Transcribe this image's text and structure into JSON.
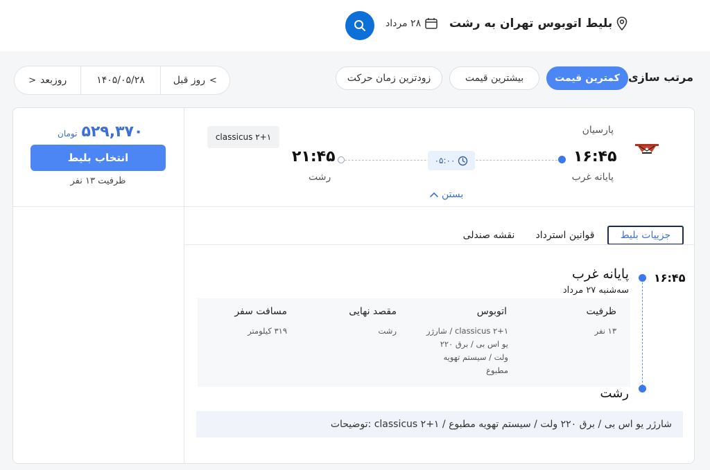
{
  "header": {
    "route_title": "بلیط اتوبوس تهران به رشت",
    "date": "۲۸ مرداد"
  },
  "sort": {
    "label": "مرتب سازی:",
    "options": [
      "کمترین قیمت",
      "بیشترین قیمت",
      "زودترین زمان حرکت"
    ],
    "active": "کمترین قیمت"
  },
  "date_nav": {
    "prev_label": "روز قبل",
    "current": "۱۴۰۵/۰۵/۲۸",
    "next_label": "روزبعد"
  },
  "ticket": {
    "company": "پارسیان",
    "bus_type": "classicus ۲+۱",
    "departure_time": "۱۶:۴۵",
    "departure_place": "پایانه غرب",
    "arrival_time": "۲۱:۴۵",
    "arrival_place": "رشت",
    "duration": "۰۵:۰۰",
    "close_label": "بستن",
    "price": "۵۲۹,۳۷۰",
    "currency": "تومان",
    "select_label": "انتخاب بلیط",
    "capacity": "ظرفیت ۱۳ نفر"
  },
  "tabs": [
    "جزییات بلیط",
    "قوانین استرداد",
    "نقشه صندلی"
  ],
  "details": {
    "time": "۱۶:۴۵",
    "origin": "پایانه غرب",
    "origin_date": "سه‌شنبه ۲۷ مرداد",
    "destination": "رشت",
    "columns": [
      {
        "header": "ظرفیت",
        "value": "۱۳ نفر"
      },
      {
        "header": "اتوبوس",
        "value": "classicus ۲+۱ / شارژر یو اس بی / برق ۲۲۰ ولت / سیستم تهویه مطبوع"
      },
      {
        "header": "مقصد نهایی",
        "value": "رشت"
      },
      {
        "header": "مسافت سفر",
        "value": "۳۱۹ کیلومتر"
      }
    ],
    "description": "توضیحات: classicus ۲+۱ / شارژر یو اس بی / برق ۲۲۰ ولت / سیستم تهویه مطبوع"
  },
  "colors": {
    "primary": "#4b86f4",
    "search_button": "#0d6fd8",
    "price": "#3c6fd8"
  }
}
